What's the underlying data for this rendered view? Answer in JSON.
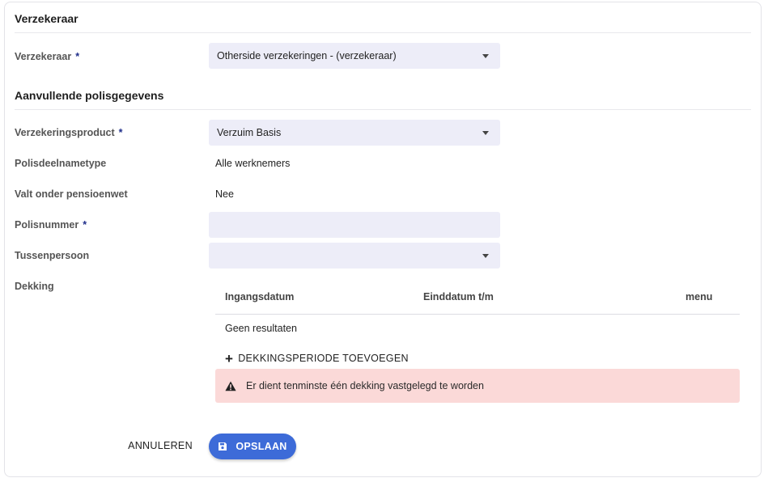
{
  "sections": {
    "insurer_title": "Verzekeraar",
    "extra_title": "Aanvullende polisgegevens"
  },
  "insurer": {
    "label": "Verzekeraar",
    "required": "*",
    "value": "Otherside verzekeringen - (verzekeraar)"
  },
  "product": {
    "label": "Verzekeringsproduct",
    "required": "*",
    "value": "Verzuim Basis"
  },
  "participation": {
    "label": "Polisdeelnametype",
    "value": "Alle werknemers"
  },
  "pension_law": {
    "label": "Valt onder pensioenwet",
    "value": "Nee"
  },
  "policy_number": {
    "label": "Polisnummer",
    "required": "*",
    "value": ""
  },
  "intermediary": {
    "label": "Tussenpersoon",
    "value": ""
  },
  "coverage": {
    "label": "Dekking",
    "columns": [
      "Ingangsdatum",
      "Einddatum t/m",
      "menu"
    ],
    "empty_text": "Geen resultaten",
    "add_label": "DEKKINGSPERIODE TOEVOEGEN",
    "alert_text": "Er dient tenminste één dekking vastgelegd te worden"
  },
  "actions": {
    "cancel_label": "ANNULEREN",
    "save_label": "OPSLAAN"
  },
  "colors": {
    "primary": "#3d6bd8",
    "field_bg": "#ededf8",
    "alert_bg": "#fbd9d8",
    "required_mark": "#1f2e8a"
  }
}
